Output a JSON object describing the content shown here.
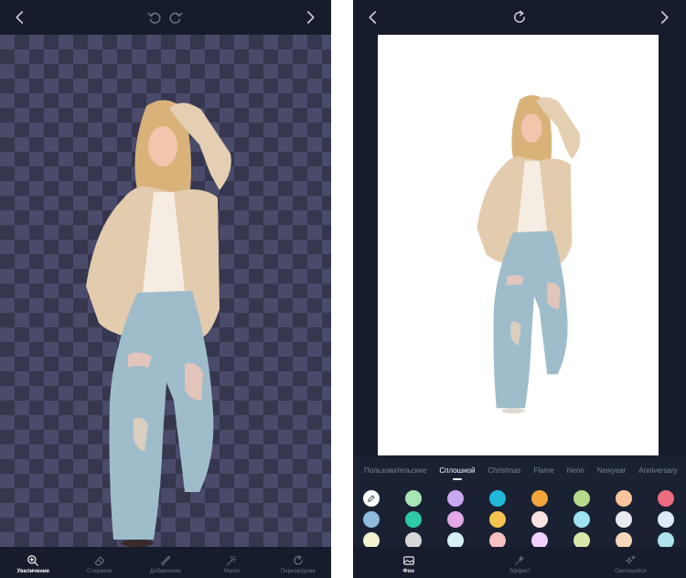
{
  "left_screen": {
    "toolbar": [
      {
        "label": "Увеличение",
        "icon": "zoom-in-icon",
        "active": true
      },
      {
        "label": "Стирание",
        "icon": "eraser-icon",
        "active": false
      },
      {
        "label": "Добавление",
        "icon": "brush-icon",
        "active": false
      },
      {
        "label": "Магия",
        "icon": "magic-wand-icon",
        "active": false
      },
      {
        "label": "Перезагрузка",
        "icon": "reload-icon",
        "active": false
      }
    ]
  },
  "right_screen": {
    "categories": [
      {
        "label": "Пользовательские",
        "active": false
      },
      {
        "label": "Сплошной",
        "active": true
      },
      {
        "label": "Christmas",
        "active": false
      },
      {
        "label": "Flame",
        "active": false
      },
      {
        "label": "Neon",
        "active": false
      },
      {
        "label": "Newyear",
        "active": false
      },
      {
        "label": "Anniversary",
        "active": false
      }
    ],
    "swatch_rows": [
      [
        "picker",
        "#a8e6b5",
        "#c9a6f2",
        "#1fb8d9",
        "#f4a63a",
        "#b7d98a",
        "#f7c49b",
        "#ee6b80"
      ],
      [
        "#8ebadb",
        "#2dc9a8",
        "#e6a9e6",
        "#f2c34f",
        "#fbe3e3",
        "#9fe3f2",
        "#e9e9ee",
        "#dfe9f9"
      ],
      [
        "#f2f2cf",
        "#d8d8d8",
        "#d5f0f5",
        "#f6c0c0",
        "#f0d0ff",
        "#d9e8a6",
        "#f7d7b9",
        "#ade4ee"
      ]
    ],
    "bottom_tabs": [
      {
        "label": "Фон",
        "icon": "background-image-icon",
        "active": true
      },
      {
        "label": "Эффект",
        "icon": "sparkle-wand-icon",
        "active": false
      },
      {
        "label": "Светящийся",
        "icon": "glow-stars-icon",
        "active": false
      }
    ]
  }
}
